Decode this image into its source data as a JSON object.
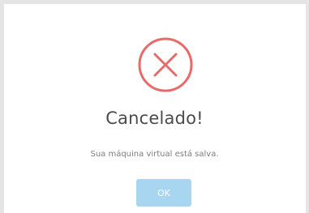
{
  "dialog": {
    "title": "Cancelado!",
    "message": "Sua máquina virtual está salva.",
    "ok_label": "OK",
    "icon": "close-icon",
    "colors": {
      "error": "#e86b6b",
      "button": "#a8d6f1"
    }
  }
}
